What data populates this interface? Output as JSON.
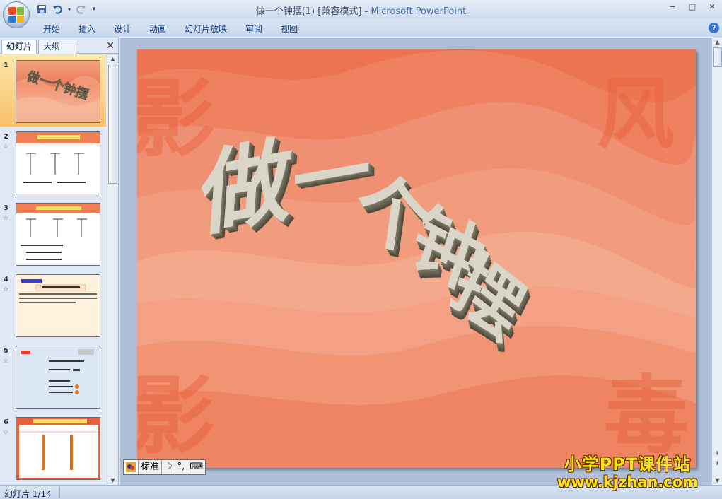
{
  "window": {
    "title": "做一个钟摆(1) [兼容模式]",
    "title_sep": " - ",
    "app_name": "Microsoft PowerPoint",
    "minimize": "−",
    "maximize": "□",
    "close": "✕"
  },
  "qat": {
    "save_icon": "save-icon",
    "undo_icon": "undo-icon",
    "redo_icon": "redo-icon",
    "customize_icon": "dropdown-icon"
  },
  "ribbon": {
    "tabs": [
      "开始",
      "插入",
      "设计",
      "动画",
      "幻灯片放映",
      "审阅",
      "视图"
    ],
    "help": "?"
  },
  "left_panel": {
    "tabs": [
      "幻灯片",
      "大纲"
    ],
    "close": "✕",
    "slides": [
      {
        "num": "1",
        "star": ""
      },
      {
        "num": "2",
        "star": "☆"
      },
      {
        "num": "3",
        "star": "☆"
      },
      {
        "num": "4",
        "star": "☆"
      },
      {
        "num": "5",
        "star": "☆"
      },
      {
        "num": "6",
        "star": "☆"
      }
    ]
  },
  "slide": {
    "title_chars": [
      "做",
      "一",
      "个",
      "钟",
      "摆"
    ],
    "background_color": "#ee7e5a"
  },
  "ime": {
    "standard": "标准",
    "moon": "☽",
    "punct": "°,",
    "keyboard": "⌨"
  },
  "watermark": {
    "line1": "小学PPT课件站",
    "line2": "www.kjzhan.com"
  },
  "status": {
    "slide_info": "幻灯片 1/14"
  }
}
